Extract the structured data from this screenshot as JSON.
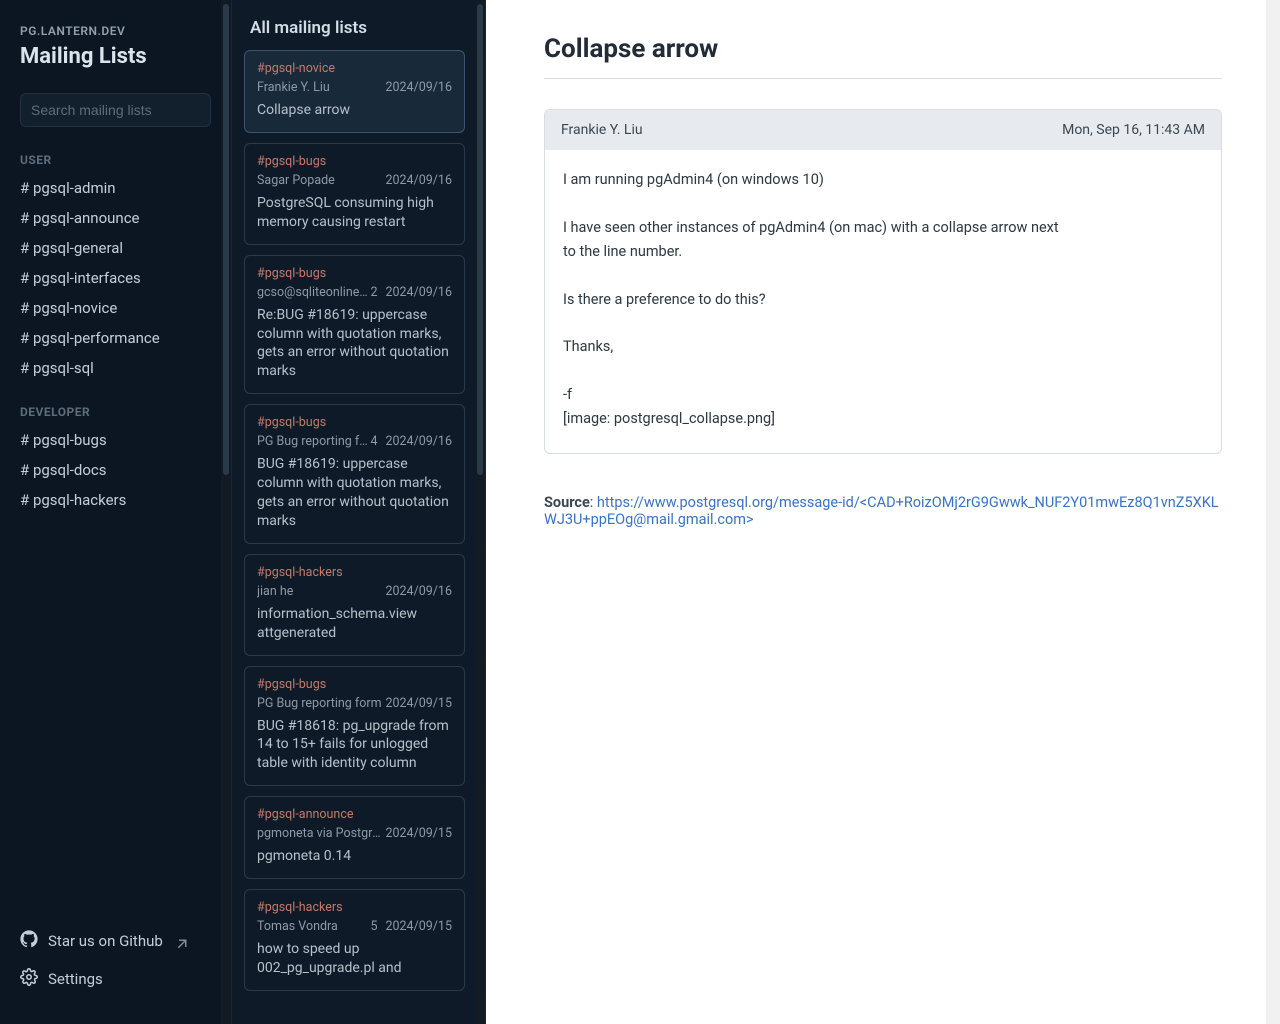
{
  "brand": {
    "site": "PG.LANTERN.DEV",
    "title": "Mailing Lists"
  },
  "search": {
    "placeholder": "Search mailing lists"
  },
  "sidebar": {
    "sections": [
      {
        "label": "USER",
        "items": [
          "# pgsql-admin",
          "# pgsql-announce",
          "# pgsql-general",
          "# pgsql-interfaces",
          "# pgsql-novice",
          "# pgsql-performance",
          "# pgsql-sql"
        ]
      },
      {
        "label": "DEVELOPER",
        "items": [
          "# pgsql-bugs",
          "# pgsql-docs",
          "# pgsql-hackers"
        ]
      }
    ],
    "footer": {
      "github": "Star us on Github",
      "settings": "Settings"
    }
  },
  "threads": {
    "header": "All mailing lists",
    "items": [
      {
        "tag": "#pgsql-novice",
        "from": "Frankie Y. Liu",
        "count": "",
        "date": "2024/09/16",
        "subject": "Collapse arrow",
        "selected": true
      },
      {
        "tag": "#pgsql-bugs",
        "from": "Sagar Popade",
        "count": "",
        "date": "2024/09/16",
        "subject": "PostgreSQL consuming high memory causing restart"
      },
      {
        "tag": "#pgsql-bugs",
        "from": "gcso@sqliteonline.com",
        "count": "2",
        "date": "2024/09/16",
        "subject": "Re:BUG #18619: uppercase column with quotation marks, gets an error without quotation marks"
      },
      {
        "tag": "#pgsql-bugs",
        "from": "PG Bug reporting form",
        "count": "4",
        "date": "2024/09/16",
        "subject": "BUG #18619: uppercase column with quotation marks, gets an error without quotation marks"
      },
      {
        "tag": "#pgsql-hackers",
        "from": "jian he",
        "count": "",
        "date": "2024/09/16",
        "subject": "information_schema.view attgenerated"
      },
      {
        "tag": "#pgsql-bugs",
        "from": "PG Bug reporting form",
        "count": "",
        "date": "2024/09/15",
        "subject": "BUG #18618: pg_upgrade from 14 to 15+ fails for unlogged table with identity column"
      },
      {
        "tag": "#pgsql-announce",
        "from": "pgmoneta via PostgreSQL Announce",
        "count": "",
        "date": "2024/09/15",
        "subject": "pgmoneta 0.14"
      },
      {
        "tag": "#pgsql-hackers",
        "from": "Tomas Vondra",
        "count": "5",
        "date": "2024/09/15",
        "subject": "how to speed up 002_pg_upgrade.pl and"
      }
    ]
  },
  "main": {
    "title": "Collapse arrow",
    "message": {
      "from": "Frankie Y. Liu",
      "date": "Mon, Sep 16, 11:43 AM",
      "body": "I am running pgAdmin4 (on windows 10)\n\nI have seen other instances of pgAdmin4 (on mac) with a collapse arrow next\nto the line number.\n\nIs there a preference to do this?\n\nThanks,\n\n-f\n[image: postgresql_collapse.png]"
    },
    "source_label": "Source",
    "source_url": "https://www.postgresql.org/message-id/<CAD+RoizOMj2rG9Gwwk_NUF2Y01mwEz8Q1vnZ5XKLWJ3U+ppEOg@mail.gmail.com>"
  }
}
